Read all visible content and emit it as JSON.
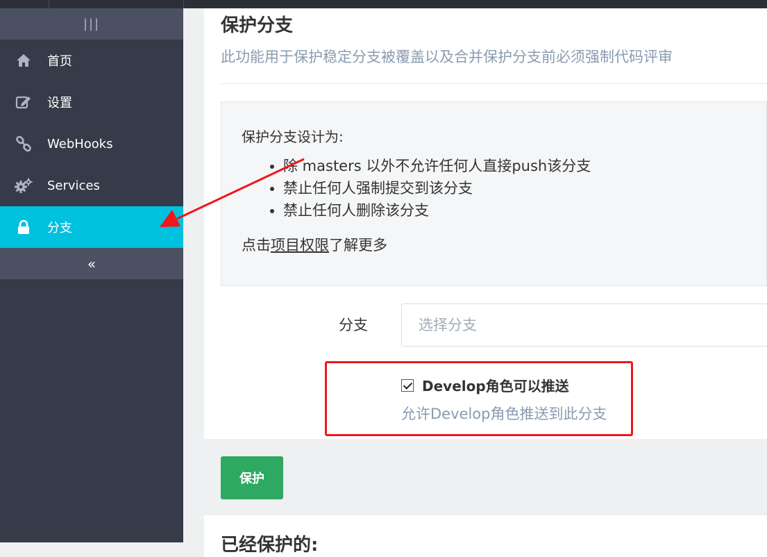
{
  "sidebar": {
    "toggle_icon": "|||",
    "collapse_icon": "«",
    "items": [
      {
        "label": "首页",
        "icon": "home-icon"
      },
      {
        "label": "设置",
        "icon": "edit-icon"
      },
      {
        "label": "WebHooks",
        "icon": "link-icon"
      },
      {
        "label": "Services",
        "icon": "gears-icon"
      },
      {
        "label": "分支",
        "icon": "lock-icon",
        "active": true
      }
    ],
    "active_color": "#00c1de"
  },
  "main": {
    "title": "保护分支",
    "subtitle": "此功能用于保护稳定分支被覆盖以及合并保护分支前必须强制代码评审",
    "info": {
      "heading": "保护分支设计为:",
      "bullets": [
        "除 masters 以外不允许任何人直接push该分支",
        "禁止任何人强制提交到该分支",
        "禁止任何人删除该分支"
      ],
      "more_prefix": "点击",
      "more_link": "项目权限",
      "more_suffix": "了解更多"
    },
    "branch": {
      "label": "分支",
      "placeholder": "选择分支"
    },
    "develop_push": {
      "label": "Develop角色可以推送",
      "help": "允许Develop角色推送到此分支",
      "checked": true
    },
    "protect_button": "保护",
    "protect_button_color": "#2ea962",
    "protected_title": "已经保护的:"
  },
  "annotation": {
    "highlight_color": "#f0161c"
  }
}
